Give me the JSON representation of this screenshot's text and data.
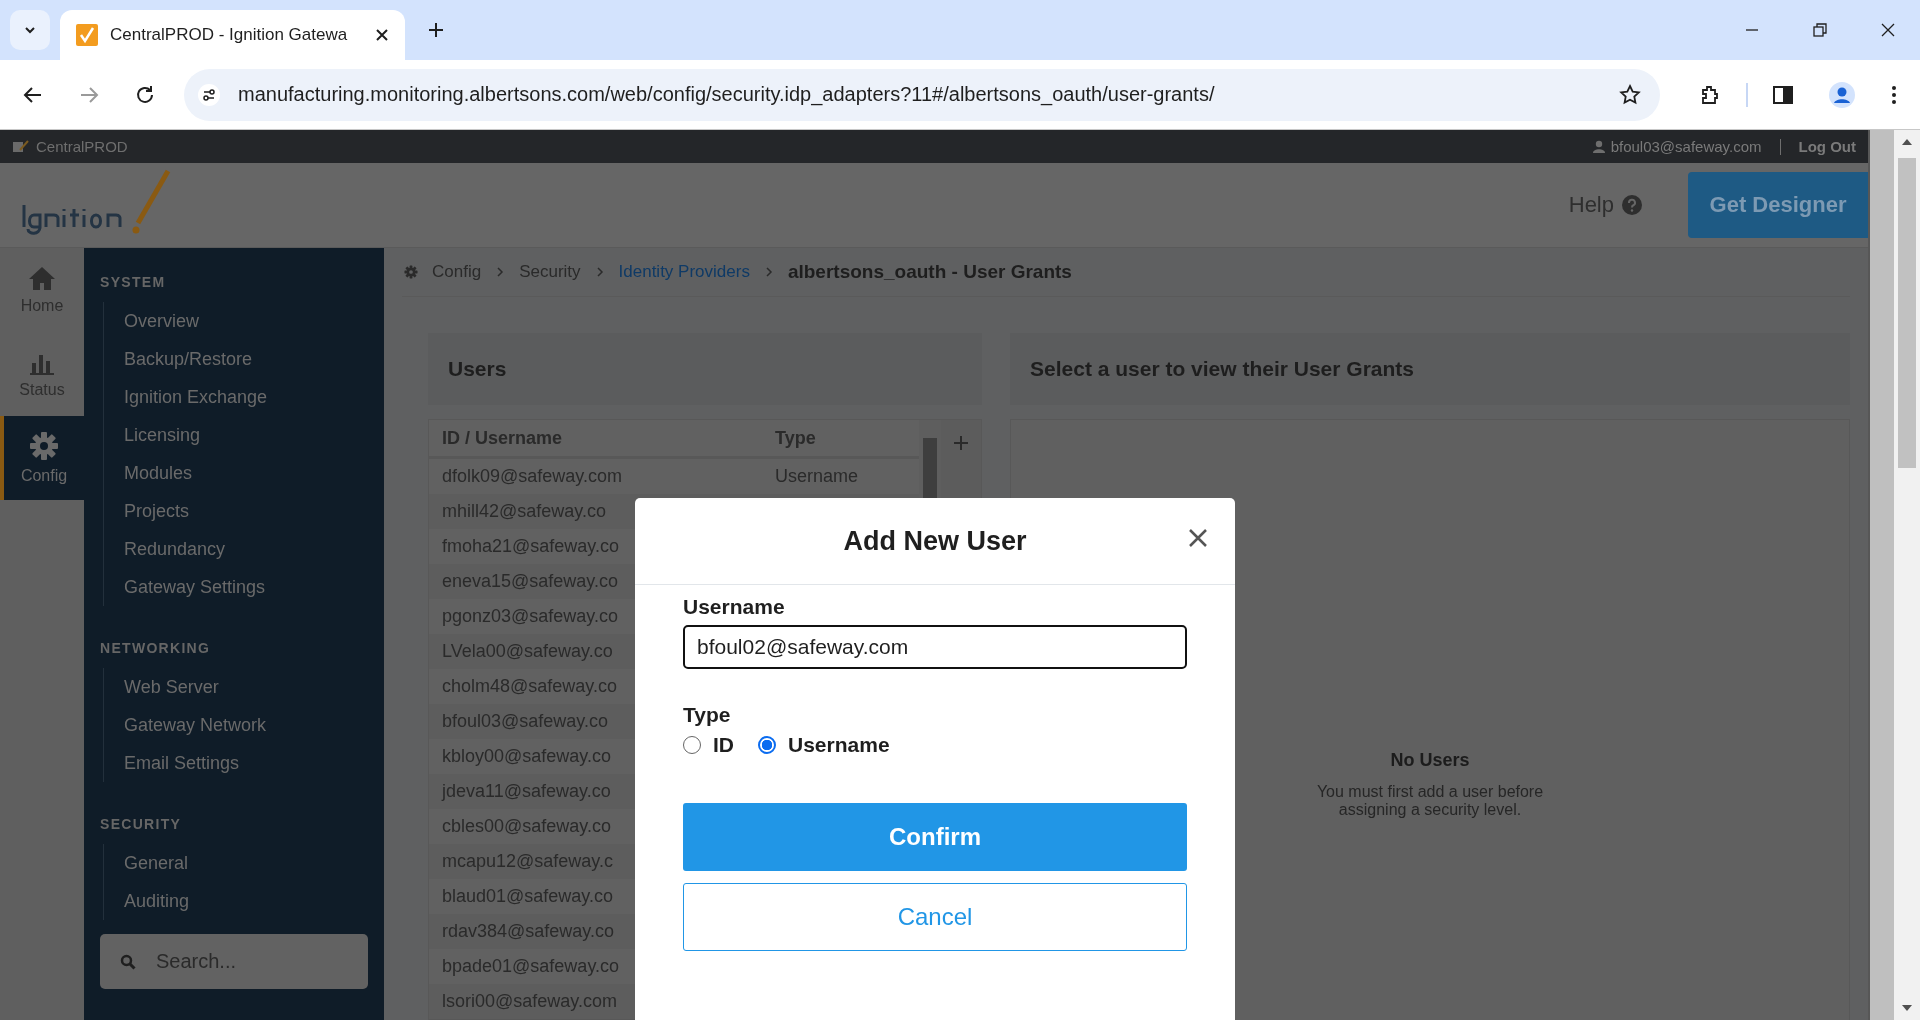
{
  "browser": {
    "tab_title": "CentralPROD - Ignition Gatewa",
    "url": "manufacturing.monitoring.albertsons.com/web/config/security.idp_adapters?11#/albertsons_oauth/user-grants/"
  },
  "top_bar": {
    "gateway_name": "CentralPROD",
    "user": "bfoul03@safeway.com",
    "logout": "Log Out"
  },
  "header": {
    "help": "Help",
    "designer_button": "Get Designer"
  },
  "rail": [
    {
      "kind": "home",
      "label": "Home",
      "selected": false
    },
    {
      "kind": "status",
      "label": "Status",
      "selected": false
    },
    {
      "kind": "config",
      "label": "Config",
      "selected": true
    }
  ],
  "nav": [
    {
      "title": "SYSTEM",
      "items": [
        "Overview",
        "Backup/Restore",
        "Ignition Exchange",
        "Licensing",
        "Modules",
        "Projects",
        "Redundancy",
        "Gateway Settings"
      ]
    },
    {
      "title": "NETWORKING",
      "items": [
        "Web Server",
        "Gateway Network",
        "Email Settings"
      ]
    },
    {
      "title": "SECURITY",
      "items": [
        "General",
        "Auditing"
      ]
    }
  ],
  "nav_search": {
    "placeholder": "Search..."
  },
  "breadcrumb": [
    {
      "label": "Config",
      "kind": "root"
    },
    {
      "label": "Security",
      "kind": "plain"
    },
    {
      "label": "Identity Providers",
      "kind": "link"
    },
    {
      "label": "albertsons_oauth - User Grants",
      "kind": "current"
    }
  ],
  "users_panel": {
    "title": "Users",
    "columns": [
      "ID / Username",
      "Type"
    ],
    "rows": [
      {
        "id": "dfolk09@safeway.com",
        "type": "Username"
      },
      {
        "id": "mhill42@safeway.co"
      },
      {
        "id": "fmoha21@safeway.co"
      },
      {
        "id": "eneva15@safeway.co"
      },
      {
        "id": "pgonz03@safeway.co"
      },
      {
        "id": "LVela00@safeway.co"
      },
      {
        "id": "cholm48@safeway.co"
      },
      {
        "id": "bfoul03@safeway.co"
      },
      {
        "id": "kbloy00@safeway.co"
      },
      {
        "id": "jdeva11@safeway.co"
      },
      {
        "id": "cbles00@safeway.co"
      },
      {
        "id": "mcapu12@safeway.c"
      },
      {
        "id": "blaud01@safeway.co"
      },
      {
        "id": "rdav384@safeway.co"
      },
      {
        "id": "bpade01@safeway.co"
      },
      {
        "id": "lsori00@safeway.com"
      }
    ]
  },
  "grants_panel": {
    "title": "Select a user to view their User Grants",
    "empty_title": "No Users",
    "empty_text": "You must first add a user before assigning a security level."
  },
  "dialog": {
    "title": "Add New User",
    "username_label": "Username",
    "username_value": "bfoul02@safeway.com",
    "type_label": "Type",
    "type_options": [
      {
        "label": "ID",
        "selected": false
      },
      {
        "label": "Username",
        "selected": true
      }
    ],
    "confirm": "Confirm",
    "cancel": "Cancel"
  }
}
